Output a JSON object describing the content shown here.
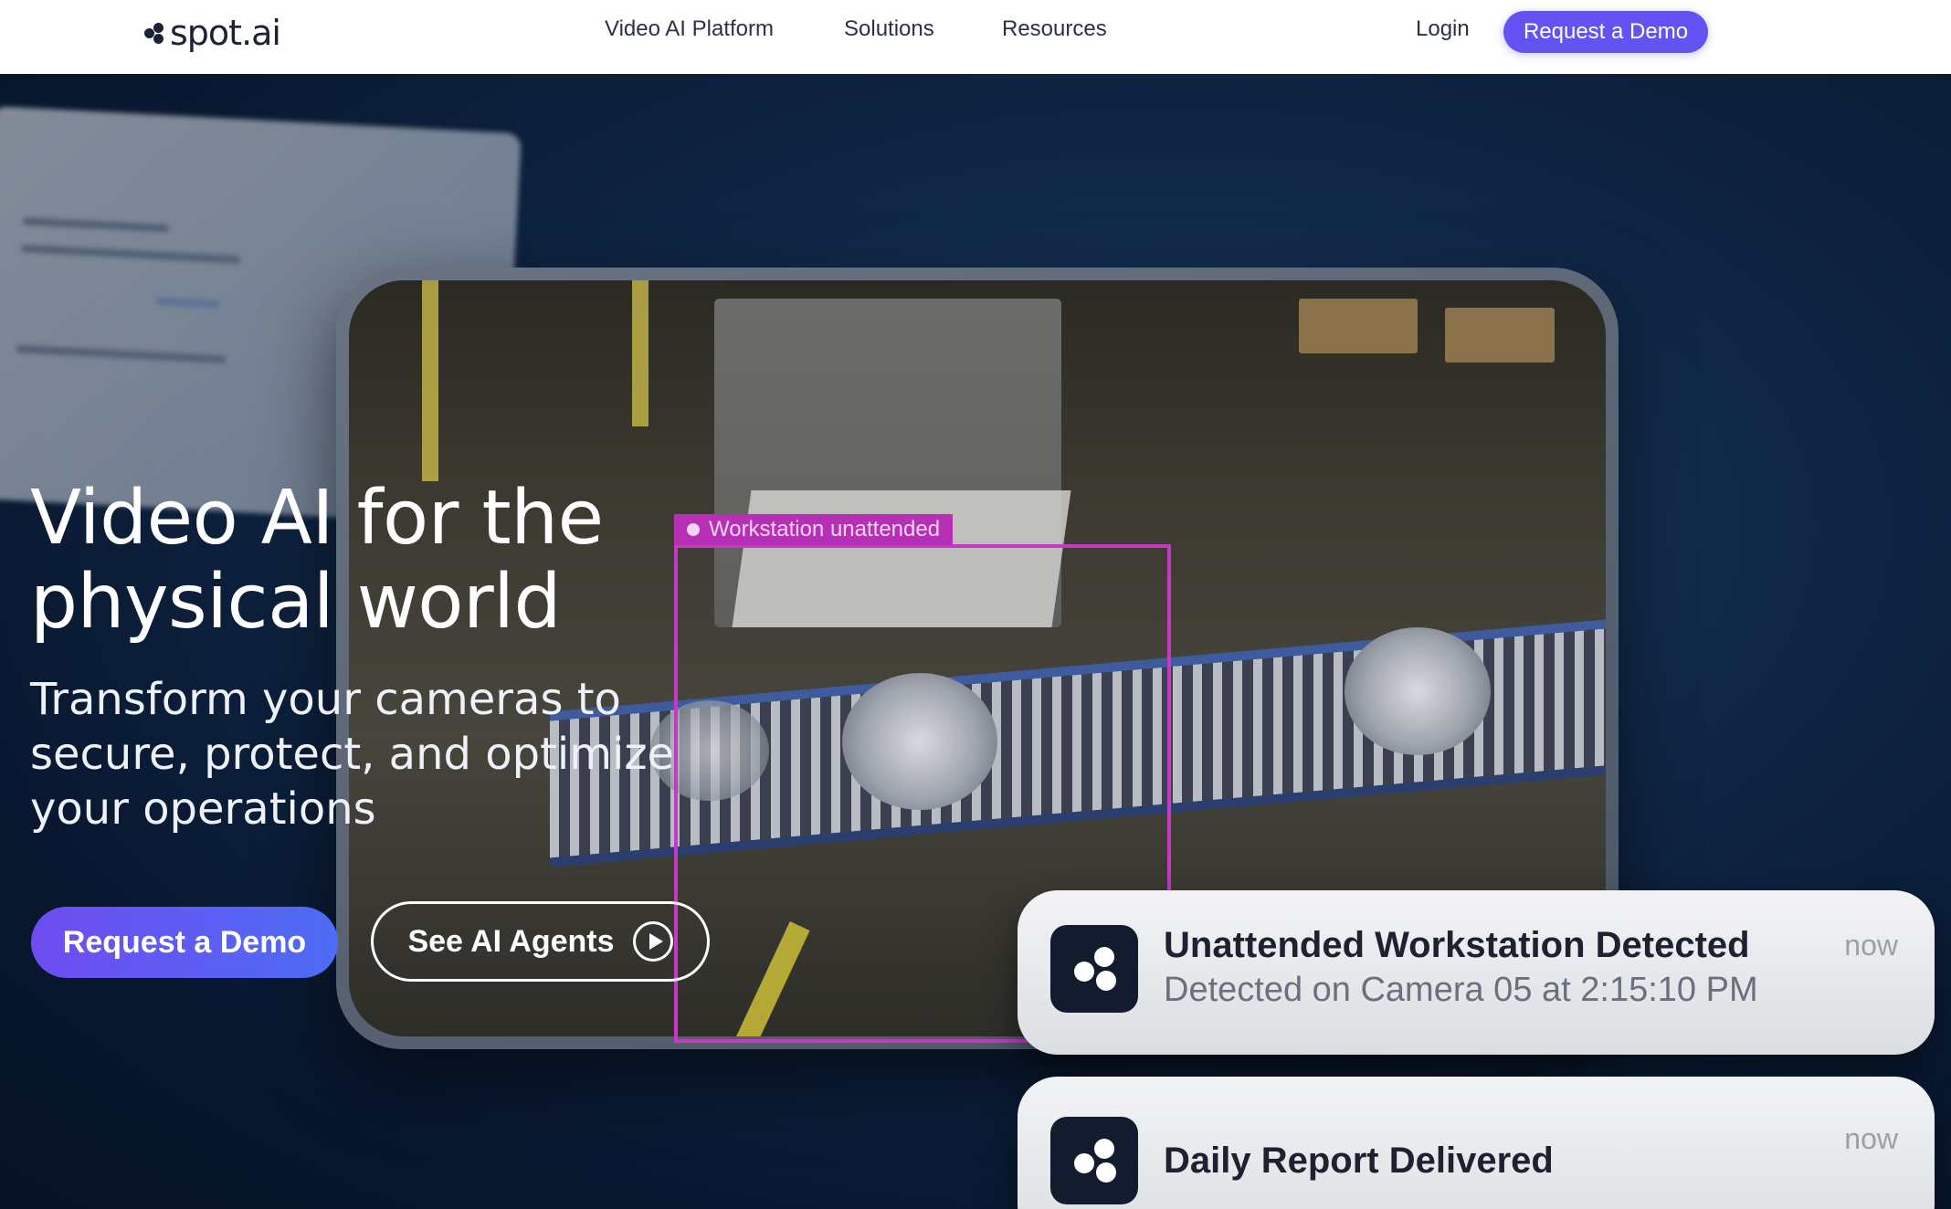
{
  "nav": {
    "logo_text": "spot.ai",
    "links": [
      "Video AI Platform",
      "Solutions",
      "Resources"
    ],
    "login": "Login",
    "cta": "Request a Demo"
  },
  "hero": {
    "title_line1": "Video AI for the",
    "title_line2": "physical world",
    "subtitle": "Transform your cameras to secure, protect, and optimize your operations",
    "primary_button": "Request a Demo",
    "secondary_button": "See AI Agents"
  },
  "video": {
    "detection_label": "Workstation unattended"
  },
  "notifications": [
    {
      "title": "Unattended Workstation Detected",
      "description": "Detected on Camera 05 at 2:15:10 PM",
      "time": "now"
    },
    {
      "title": "Daily Report Delivered",
      "description": "",
      "time": "now"
    }
  ],
  "colors": {
    "brand_purple": "#6453f3",
    "detection_magenta": "#c43ac2",
    "hero_background": "#0f2645"
  }
}
